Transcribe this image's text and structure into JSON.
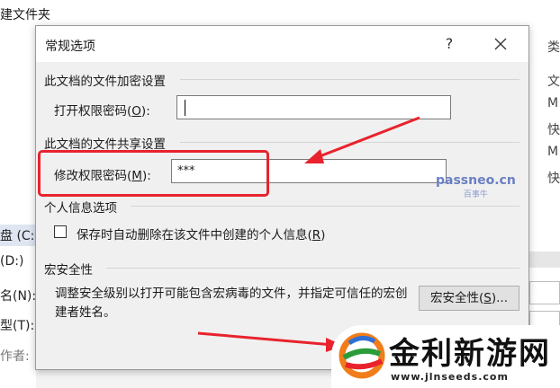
{
  "background_window": {
    "top_text": "建文件夹",
    "right_items": [
      "类",
      "文",
      "M",
      "快",
      "M",
      "快"
    ],
    "left_items": [
      "盘 (C:)",
      "(D:)",
      "名(N):",
      "型(T):",
      "作者:"
    ]
  },
  "dialog": {
    "title": "常规选项",
    "help_symbol": "?",
    "encryption": {
      "heading": "此文档的文件加密设置",
      "open_label_prefix": "打开权限密码(",
      "open_label_key": "O",
      "open_label_suffix": "):",
      "open_value": ""
    },
    "sharing": {
      "heading": "此文档的文件共享设置",
      "modify_label_prefix": "修改权限密码(",
      "modify_label_key": "M",
      "modify_label_suffix": "):",
      "modify_value": "***"
    },
    "privacy": {
      "heading": "个人信息选项",
      "checkbox_label_prefix": "保存时自动删除在该文件中创建的个人信息(",
      "checkbox_label_key": "R",
      "checkbox_label_suffix": ")",
      "checked": false
    },
    "macro": {
      "heading": "宏安全性",
      "description": "调整安全级别以打开可能包含宏病毒的文件，并指定可信任的宏创建者姓名。",
      "button_prefix": "宏安全性(",
      "button_key": "S",
      "button_suffix": ")..."
    }
  },
  "watermark": {
    "site": "passneo.cn",
    "site_cn": "百事牛",
    "logo_text": "金利新游网",
    "logo_url": "www.jlnseeds.com"
  },
  "colors": {
    "annotation_red": "#e8232d",
    "dialog_bg": "#f0f0f0"
  }
}
